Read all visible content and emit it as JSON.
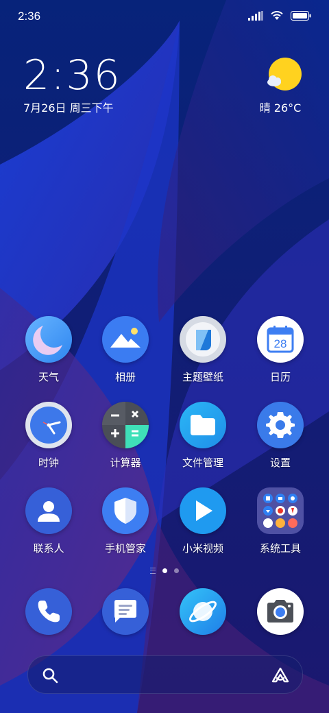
{
  "status_bar": {
    "time": "2:36"
  },
  "clock": {
    "time": "2:36",
    "date": "7月26日 周三下午"
  },
  "weather": {
    "text": "晴 26°C"
  },
  "apps": [
    {
      "label": "天气",
      "icon": "weather-moon-icon"
    },
    {
      "label": "相册",
      "icon": "gallery-icon"
    },
    {
      "label": "主题壁纸",
      "icon": "themes-icon"
    },
    {
      "label": "日历",
      "icon": "calendar-icon",
      "day": "28"
    },
    {
      "label": "时钟",
      "icon": "clock-icon"
    },
    {
      "label": "计算器",
      "icon": "calculator-icon"
    },
    {
      "label": "文件管理",
      "icon": "folder-icon"
    },
    {
      "label": "设置",
      "icon": "gear-icon"
    },
    {
      "label": "联系人",
      "icon": "contacts-icon"
    },
    {
      "label": "手机管家",
      "icon": "security-shield-icon"
    },
    {
      "label": "小米视频",
      "icon": "video-play-icon"
    },
    {
      "label": "系统工具",
      "icon": "folder-grid-icon"
    }
  ],
  "dock": [
    {
      "icon": "phone-icon"
    },
    {
      "icon": "messages-icon"
    },
    {
      "icon": "browser-icon"
    },
    {
      "icon": "camera-icon"
    }
  ],
  "pager": {
    "active_page": 1
  }
}
